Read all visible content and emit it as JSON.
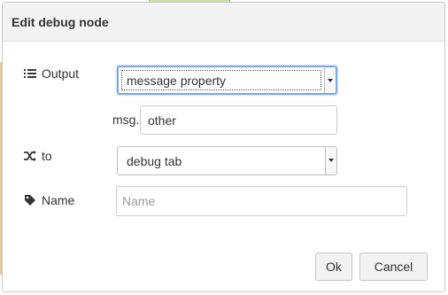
{
  "dialog": {
    "title": "Edit debug node"
  },
  "form": {
    "output": {
      "label": "Output",
      "icon": "list-icon",
      "selected": "message property",
      "prefix": "msg.",
      "property_value": "other"
    },
    "to": {
      "label": "to",
      "icon": "shuffle-icon",
      "selected": "debug tab"
    },
    "name": {
      "label": "Name",
      "icon": "tag-icon",
      "placeholder": "Name",
      "value": ""
    }
  },
  "buttons": {
    "ok": "Ok",
    "cancel": "Cancel"
  },
  "colors": {
    "focus_border": "#7aa7e8",
    "titlebar_bg": "#f3f3f3"
  }
}
